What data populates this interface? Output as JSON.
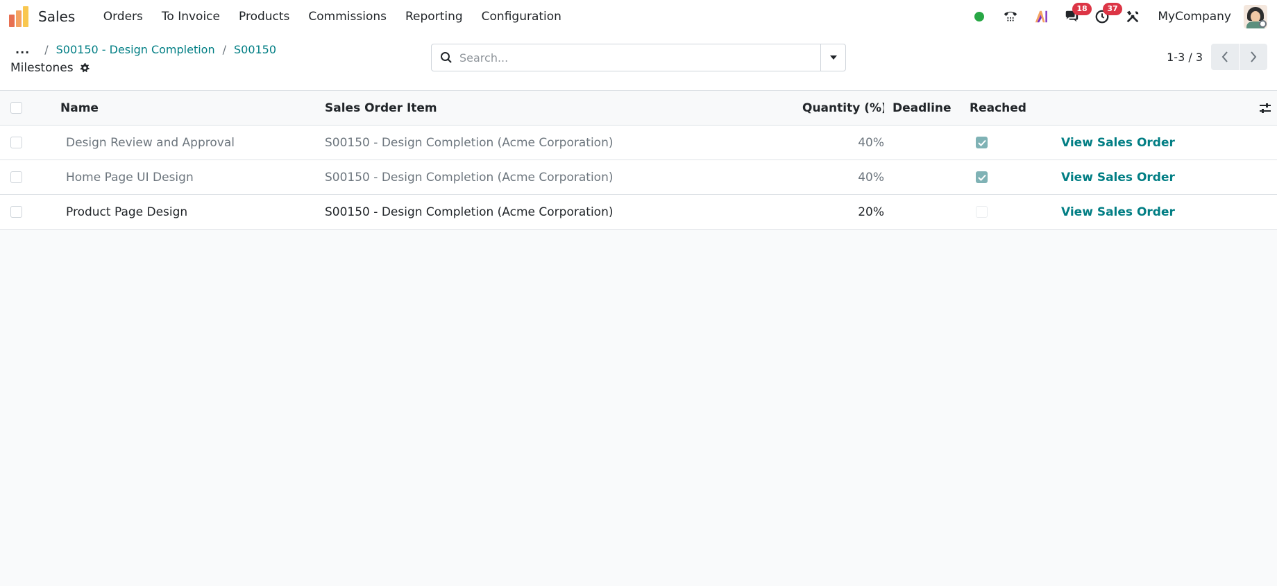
{
  "navbar": {
    "app_name": "Sales",
    "logo_colors": [
      "#f4a261",
      "#e76f51",
      "#7b2cbf"
    ],
    "menu": [
      {
        "label": "Orders"
      },
      {
        "label": "To Invoice"
      },
      {
        "label": "Products"
      },
      {
        "label": "Commissions"
      },
      {
        "label": "Reporting"
      },
      {
        "label": "Configuration"
      }
    ],
    "messages_badge": "18",
    "activities_badge": "37",
    "company": "MyCompany",
    "status_color": "#28a745"
  },
  "control_panel": {
    "breadcrumb": {
      "dots": "...",
      "items": [
        {
          "label": "S00150 - Design Completion"
        },
        {
          "label": "S00150"
        }
      ]
    },
    "title": "Milestones",
    "search": {
      "placeholder": "Search..."
    },
    "pager": {
      "value": "1-3 / 3"
    }
  },
  "list": {
    "headers": {
      "name": "Name",
      "sales_order_item": "Sales Order Item",
      "quantity": "Quantity (%)",
      "deadline": "Deadline",
      "reached": "Reached"
    },
    "rows": [
      {
        "name": "Design Review and Approval",
        "sales_order_item": "S00150 - Design Completion (Acme Corporation)",
        "quantity": "40%",
        "deadline": "",
        "reached": true,
        "action": "View Sales Order"
      },
      {
        "name": "Home Page UI Design",
        "sales_order_item": "S00150 - Design Completion (Acme Corporation)",
        "quantity": "40%",
        "deadline": "",
        "reached": true,
        "action": "View Sales Order"
      },
      {
        "name": "Product Page Design",
        "sales_order_item": "S00150 - Design Completion (Acme Corporation)",
        "quantity": "20%",
        "deadline": "",
        "reached": false,
        "action": "View Sales Order"
      }
    ]
  },
  "colors": {
    "accent": "#017e84",
    "reached_checked": "#7fb2b5",
    "badge": "#dc3545"
  }
}
